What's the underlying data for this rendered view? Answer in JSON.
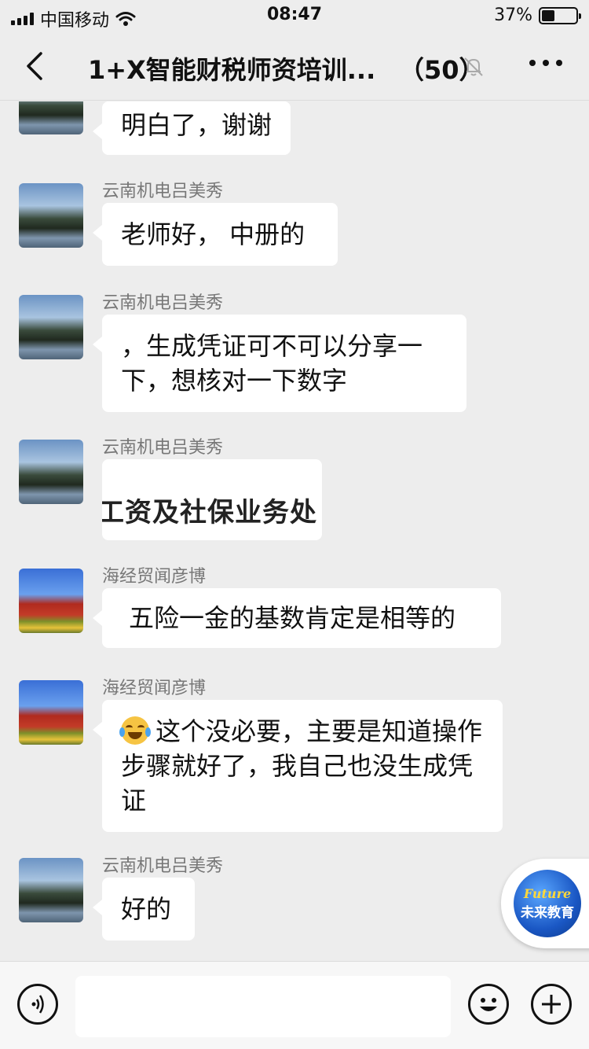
{
  "status_bar": {
    "carrier": "中国移动",
    "time": "08:47",
    "battery_text": "37%",
    "battery_level": 0.37
  },
  "nav": {
    "title": "1+X智能财税师资培训...",
    "member_count": "（50）"
  },
  "messages": [
    {
      "sender": "",
      "text": "明白了，谢谢",
      "avatar": "lake"
    },
    {
      "sender": "云南机电吕美秀",
      "text": "老师好， 中册的",
      "avatar": "lake"
    },
    {
      "sender": "云南机电吕美秀",
      "text": "，生成凭证可不可以分享一下，想核对一下数字",
      "avatar": "lake"
    },
    {
      "sender": "云南机电吕美秀",
      "image_text": "工资及社保业务处",
      "avatar": "lake"
    },
    {
      "sender": "海经贸闻彦博",
      "text": "五险一金的基数肯定是相等的",
      "avatar": "gate"
    },
    {
      "sender": "海经贸闻彦博",
      "emoji": "face-with-tears-of-joy-icon",
      "text": "这个没必要，主要是知道操作步骤就好了，我自己也没生成凭证",
      "avatar": "gate"
    },
    {
      "sender": "云南机电吕美秀",
      "text": "好的",
      "avatar": "lake"
    }
  ],
  "floating_badge": {
    "logo_en": "Future",
    "logo_zh": "未来教育"
  },
  "input_bar": {
    "value": ""
  }
}
